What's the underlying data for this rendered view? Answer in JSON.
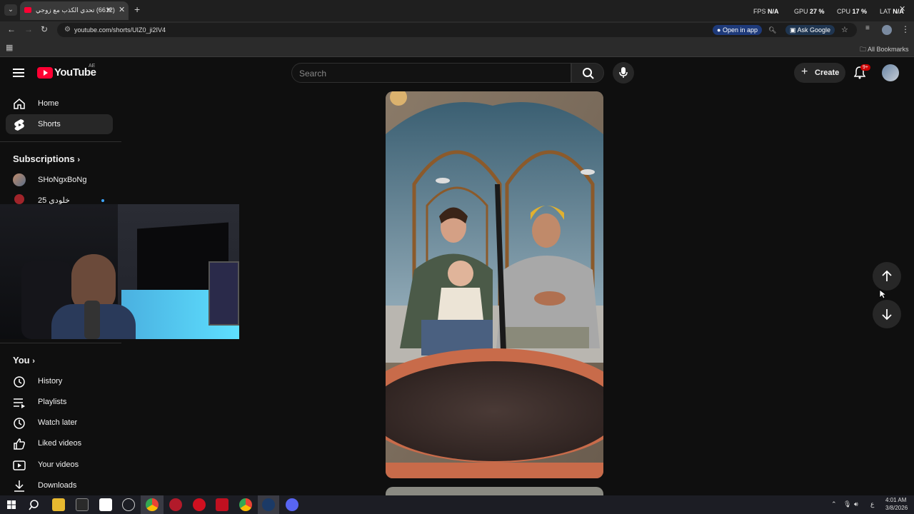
{
  "browser": {
    "tab_title": "(6612) تحدي الكذب مع زوجي",
    "tab_audio_icon": "speaker-icon",
    "new_tab_label": "+",
    "perf": {
      "fps_label": "FPS",
      "fps_value": "N/A",
      "gpu_label": "GPU",
      "gpu_value": "27 %",
      "cpu_label": "CPU",
      "cpu_value": "17 %",
      "lat_label": "LAT",
      "lat_value": "N/A"
    },
    "url": "youtube.com/shorts/UIZ0_ji2IV4",
    "open_in_app": "Open in app",
    "ask_google": "Ask Google",
    "all_bookmarks": "All Bookmarks"
  },
  "youtube": {
    "logo_text": "YouTube",
    "region": "AE",
    "search_placeholder": "Search",
    "create_label": "Create",
    "notification_count": "9+"
  },
  "sidebar": {
    "home": "Home",
    "shorts": "Shorts",
    "subscriptions_header": "Subscriptions",
    "subscriptions": [
      {
        "name": "SHoNgxBoNg"
      },
      {
        "name": "خلودي 25"
      }
    ],
    "you_header": "You",
    "you_items": [
      {
        "label": "History",
        "icon": "history-icon"
      },
      {
        "label": "Playlists",
        "icon": "playlist-icon"
      },
      {
        "label": "Watch later",
        "icon": "clock-icon"
      },
      {
        "label": "Liked videos",
        "icon": "thumbs-up-icon"
      },
      {
        "label": "Your videos",
        "icon": "video-icon"
      },
      {
        "label": "Downloads",
        "icon": "download-icon"
      }
    ]
  },
  "taskbar": {
    "language": "ع",
    "time": "4:01 AM",
    "date": "3/8/2026"
  },
  "colors": {
    "yt_red": "#ff0033",
    "bg": "#0f0f0f",
    "chip": "#272727",
    "open_in_app_bg": "#1e3a7a",
    "ask_google_bg": "#1f3550"
  }
}
